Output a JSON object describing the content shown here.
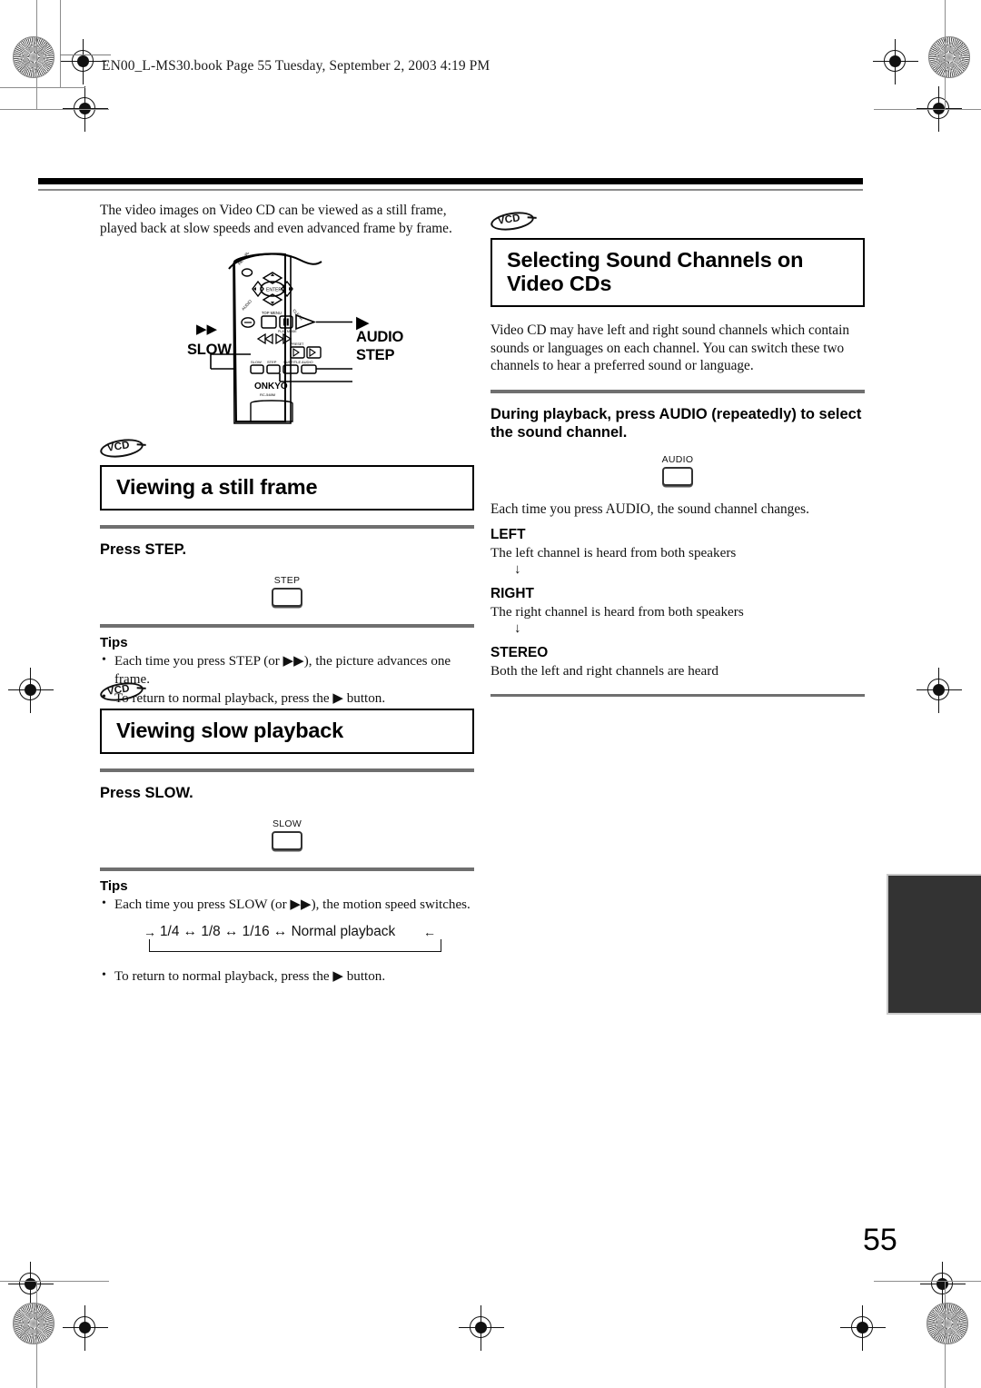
{
  "header": {
    "file_line": "EN00_L-MS30.book  Page 55  Tuesday, September 2, 2003  4:19 PM"
  },
  "page": {
    "number": "55"
  },
  "left_column": {
    "intro": "The video images on Video CD can be viewed as a still frame, played back at slow speeds and even advanced frame by frame.",
    "remote": {
      "brand": "ONKYO",
      "model": "RC-548M",
      "callouts": {
        "slow": "SLOW",
        "audio": "AUDIO",
        "step": "STEP",
        "play_glyph": "▶",
        "ff_glyph": "▶▶"
      },
      "keys": [
        "SLOW",
        "STEP",
        "SUBTITLE",
        "AUDIO"
      ],
      "center_label": "ENTER"
    },
    "section_still": {
      "badge": "VCD",
      "title": "Viewing a still frame",
      "instruction": "Press STEP.",
      "button_label": "STEP",
      "tips_title": "Tips",
      "tips": [
        "Each time you press STEP (or ▶▶), the picture advances one frame.",
        "To return to normal playback, press the ▶ button."
      ]
    },
    "section_slow": {
      "badge": "VCD",
      "title": "Viewing slow playback",
      "instruction": "Press SLOW.",
      "button_label": "SLOW",
      "tips_title": "Tips",
      "tip_first": "Each time you press SLOW (or ▶▶), the motion speed switches.",
      "cycle": {
        "lead_in": "→",
        "sequence": "1/4 ↔ 1/8 ↔ 1/16 ↔ Normal playback",
        "lead_out": "←"
      },
      "tip_last": "To return to normal playback, press the ▶ button."
    }
  },
  "right_column": {
    "badge": "VCD",
    "title": "Selecting Sound Channels on Video CDs",
    "intro": "Video CD may have left and right sound channels which contain sounds or languages on each channel. You can switch these two channels to hear a preferred sound or language.",
    "instruction": "During playback, press AUDIO (repeatedly) to select the sound channel.",
    "button_label": "AUDIO",
    "note": "Each time you press AUDIO, the sound channel changes.",
    "channels": [
      {
        "name": "LEFT",
        "desc": "The left channel is heard from both speakers",
        "arrow": "↓"
      },
      {
        "name": "RIGHT",
        "desc": "The right channel is heard from both speakers",
        "arrow": "↓"
      },
      {
        "name": "STEREO",
        "desc": "Both the left and right channels are heard",
        "arrow": ""
      }
    ]
  }
}
